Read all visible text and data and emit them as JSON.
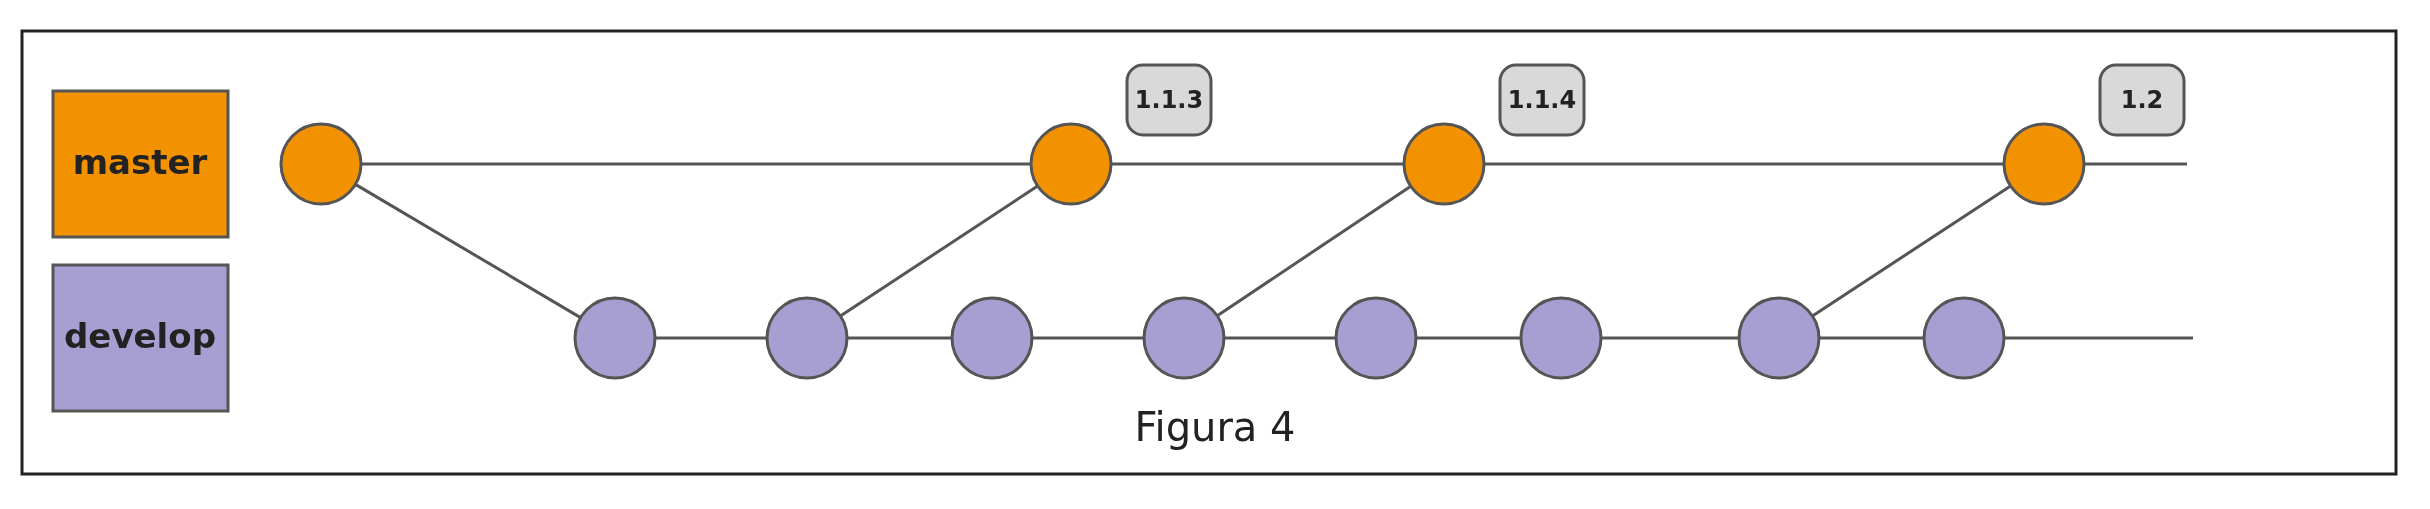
{
  "branches": [
    {
      "label": "master",
      "color": "#f39200",
      "commits": [
        {
          "kind": "start"
        },
        {
          "kind": "merge",
          "tag": "1.1.3"
        },
        {
          "kind": "merge",
          "tag": "1.1.4"
        },
        {
          "kind": "merge",
          "tag": "1.2"
        }
      ]
    },
    {
      "label": "develop",
      "color": "#a79fd1",
      "commits": [
        {
          "kind": "branch-point"
        },
        {
          "kind": "merge-source"
        },
        {
          "kind": "plain"
        },
        {
          "kind": "merge-source"
        },
        {
          "kind": "plain"
        },
        {
          "kind": "plain"
        },
        {
          "kind": "merge-source"
        },
        {
          "kind": "plain"
        }
      ]
    }
  ],
  "caption": "Figura 4"
}
